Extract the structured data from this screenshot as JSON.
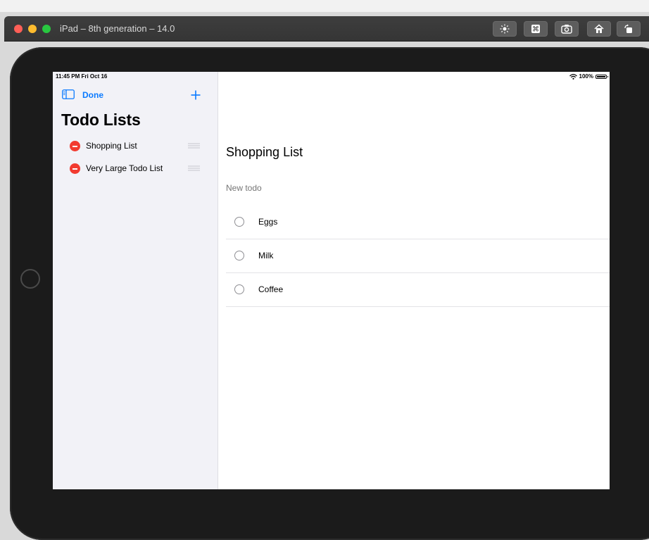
{
  "window": {
    "title": "iPad – 8th generation – 14.0",
    "toolbar_icons": [
      "brightness-icon",
      "command-icon",
      "screenshot-icon",
      "home-icon",
      "rotate-icon"
    ]
  },
  "status_bar": {
    "time": "11:45 PM  Fri Oct 16",
    "battery": "100%"
  },
  "sidebar": {
    "done_label": "Done",
    "title": "Todo Lists",
    "items": [
      {
        "label": "Shopping List"
      },
      {
        "label": "Very Large Todo List"
      }
    ]
  },
  "detail": {
    "title": "Shopping List",
    "new_todo_placeholder": "New todo",
    "todos": [
      {
        "label": "Eggs"
      },
      {
        "label": "Milk"
      },
      {
        "label": "Coffee"
      }
    ]
  },
  "colors": {
    "accent": "#0a7aff",
    "delete_red": "#f23b30",
    "sidebar_bg": "#f2f2f7"
  }
}
